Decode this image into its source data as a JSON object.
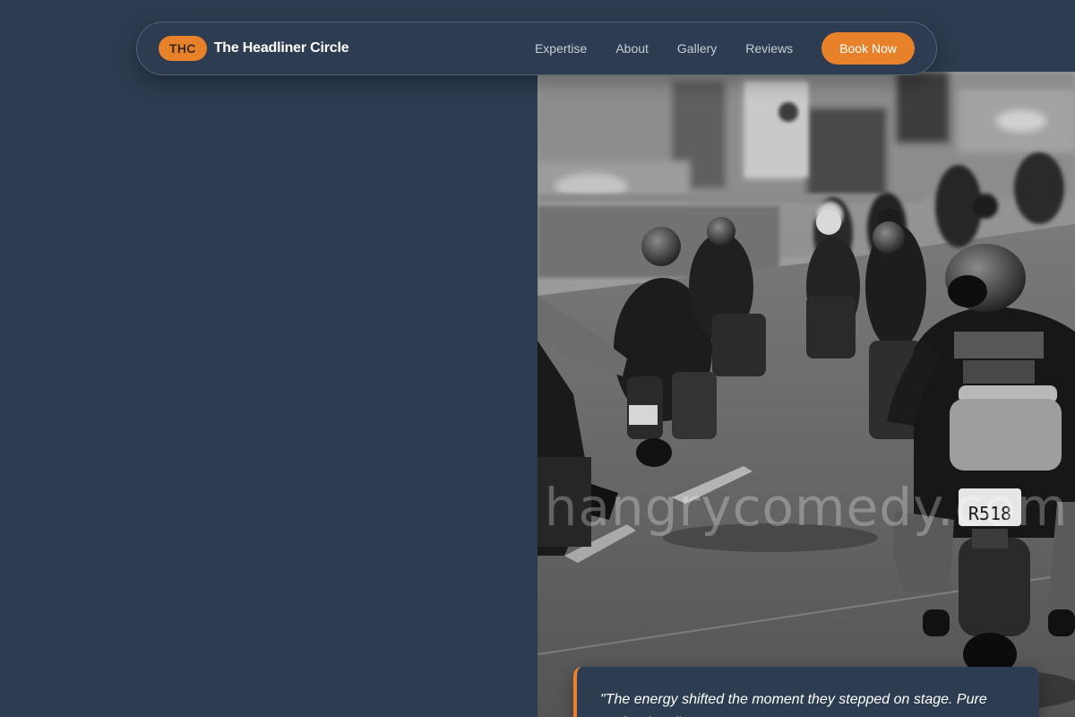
{
  "brand": {
    "badge": "THC",
    "name": "The Headliner Circle"
  },
  "nav": {
    "links": [
      "Expertise",
      "About",
      "Gallery",
      "Reviews"
    ],
    "cta_label": "Book Now"
  },
  "hero": {
    "watermark": "hangrycomedy.com",
    "plate_text": "R518"
  },
  "testimonial": {
    "quote": "\"The energy shifted the moment they stepped on stage. Pure professionalism.\""
  },
  "colors": {
    "background": "#2c3b4f",
    "accent": "#e8822a",
    "text": "#ffffff",
    "muted_text": "#c7ced8"
  }
}
